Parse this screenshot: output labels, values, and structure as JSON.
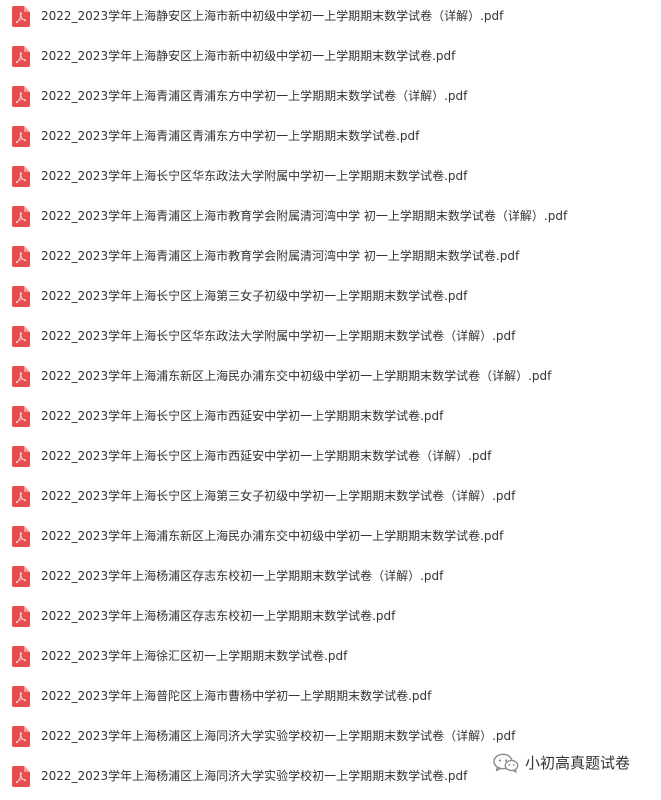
{
  "colors": {
    "pdf_icon_bg": "#e84d4d",
    "pdf_icon_fg": "#ffffff",
    "text": "#333333",
    "background": "#ffffff"
  },
  "file_icon": "pdf-file-icon",
  "files": [
    "2022_2023学年上海静安区上海市新中初级中学初一上学期期末数学试卷（详解）.pdf",
    "2022_2023学年上海静安区上海市新中初级中学初一上学期期末数学试卷.pdf",
    "2022_2023学年上海青浦区青浦东方中学初一上学期期末数学试卷（详解）.pdf",
    "2022_2023学年上海青浦区青浦东方中学初一上学期期末数学试卷.pdf",
    "2022_2023学年上海长宁区华东政法大学附属中学初一上学期期末数学试卷.pdf",
    "2022_2023学年上海青浦区上海市教育学会附属清河湾中学 初一上学期期末数学试卷（详解）.pdf",
    "2022_2023学年上海青浦区上海市教育学会附属清河湾中学 初一上学期期末数学试卷.pdf",
    "2022_2023学年上海长宁区上海第三女子初级中学初一上学期期末数学试卷.pdf",
    "2022_2023学年上海长宁区华东政法大学附属中学初一上学期期末数学试卷（详解）.pdf",
    "2022_2023学年上海浦东新区上海民办浦东交中初级中学初一上学期期末数学试卷（详解）.pdf",
    "2022_2023学年上海长宁区上海市西延安中学初一上学期期末数学试卷.pdf",
    "2022_2023学年上海长宁区上海市西延安中学初一上学期期末数学试卷（详解）.pdf",
    "2022_2023学年上海长宁区上海第三女子初级中学初一上学期期末数学试卷（详解）.pdf",
    "2022_2023学年上海浦东新区上海民办浦东交中初级中学初一上学期期末数学试卷.pdf",
    "2022_2023学年上海杨浦区存志东校初一上学期期末数学试卷（详解）.pdf",
    "2022_2023学年上海杨浦区存志东校初一上学期期末数学试卷.pdf",
    "2022_2023学年上海徐汇区初一上学期期末数学试卷.pdf",
    "2022_2023学年上海普陀区上海市曹杨中学初一上学期期末数学试卷.pdf",
    "2022_2023学年上海杨浦区上海同济大学实验学校初一上学期期末数学试卷（详解）.pdf",
    "2022_2023学年上海杨浦区上海同济大学实验学校初一上学期期末数学试卷.pdf"
  ],
  "watermark": {
    "icon": "wechat-icon",
    "text": "小初高真题试卷"
  }
}
